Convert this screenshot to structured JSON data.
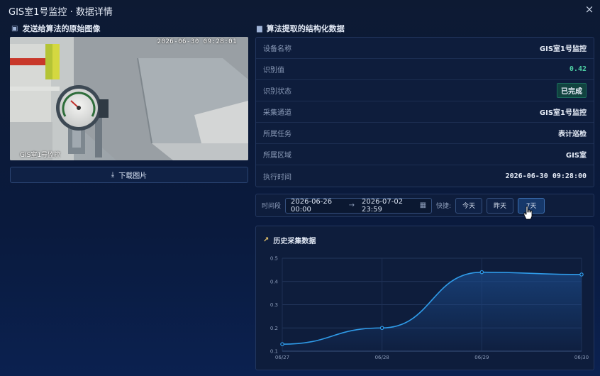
{
  "window": {
    "title": "GIS室1号监控 · 数据详情",
    "close_label": "×"
  },
  "left_section": {
    "title": "发送给算法的原始图像",
    "icon": "camera-icon",
    "photo": {
      "timestamp_overlay": "2026-06-30 09:28:01",
      "caption_overlay": "GIS室1号监控"
    },
    "download_label": "下载图片",
    "download_icon": "download-icon"
  },
  "right_section": {
    "title": "算法提取的结构化数据",
    "icon": "bar-chart-icon",
    "rows": [
      {
        "label": "设备名称",
        "value": "GIS室1号监控"
      },
      {
        "label": "识别值",
        "value": "0.42"
      },
      {
        "label": "识别状态",
        "value": "已完成"
      },
      {
        "label": "采集通道",
        "value": "GIS室1号监控"
      },
      {
        "label": "所属任务",
        "value": "表计巡检"
      },
      {
        "label": "所属区域",
        "value": "GIS室"
      },
      {
        "label": "执行时间",
        "value": "2026-06-30 09:28:00"
      }
    ]
  },
  "filter": {
    "range_label": "时间段",
    "start": "2026-06-26 00:00",
    "separator": "→",
    "end": "2026-07-02 23:59",
    "quick_label": "快捷:",
    "quick_buttons": [
      "今天",
      "昨天",
      "7天"
    ],
    "active_quick": "7天"
  },
  "history": {
    "title": "历史采集数据",
    "icon": "line-chart-icon"
  },
  "chart_data": {
    "type": "area",
    "title": "历史采集数据",
    "x": [
      "06/27",
      "06/28",
      "06/29",
      "06/30"
    ],
    "values": [
      0.13,
      0.2,
      0.44,
      0.43
    ],
    "ylim": [
      0.1,
      0.5
    ],
    "yticks": [
      0.1,
      0.2,
      0.3,
      0.4,
      0.5
    ],
    "grid": true,
    "smooth": true,
    "line_color": "#2f9be8",
    "fill_color": "#1b4a8a"
  },
  "colors": {
    "accent": "#2f9be8",
    "success": "#39d0a0",
    "background": "#0d1a33"
  }
}
